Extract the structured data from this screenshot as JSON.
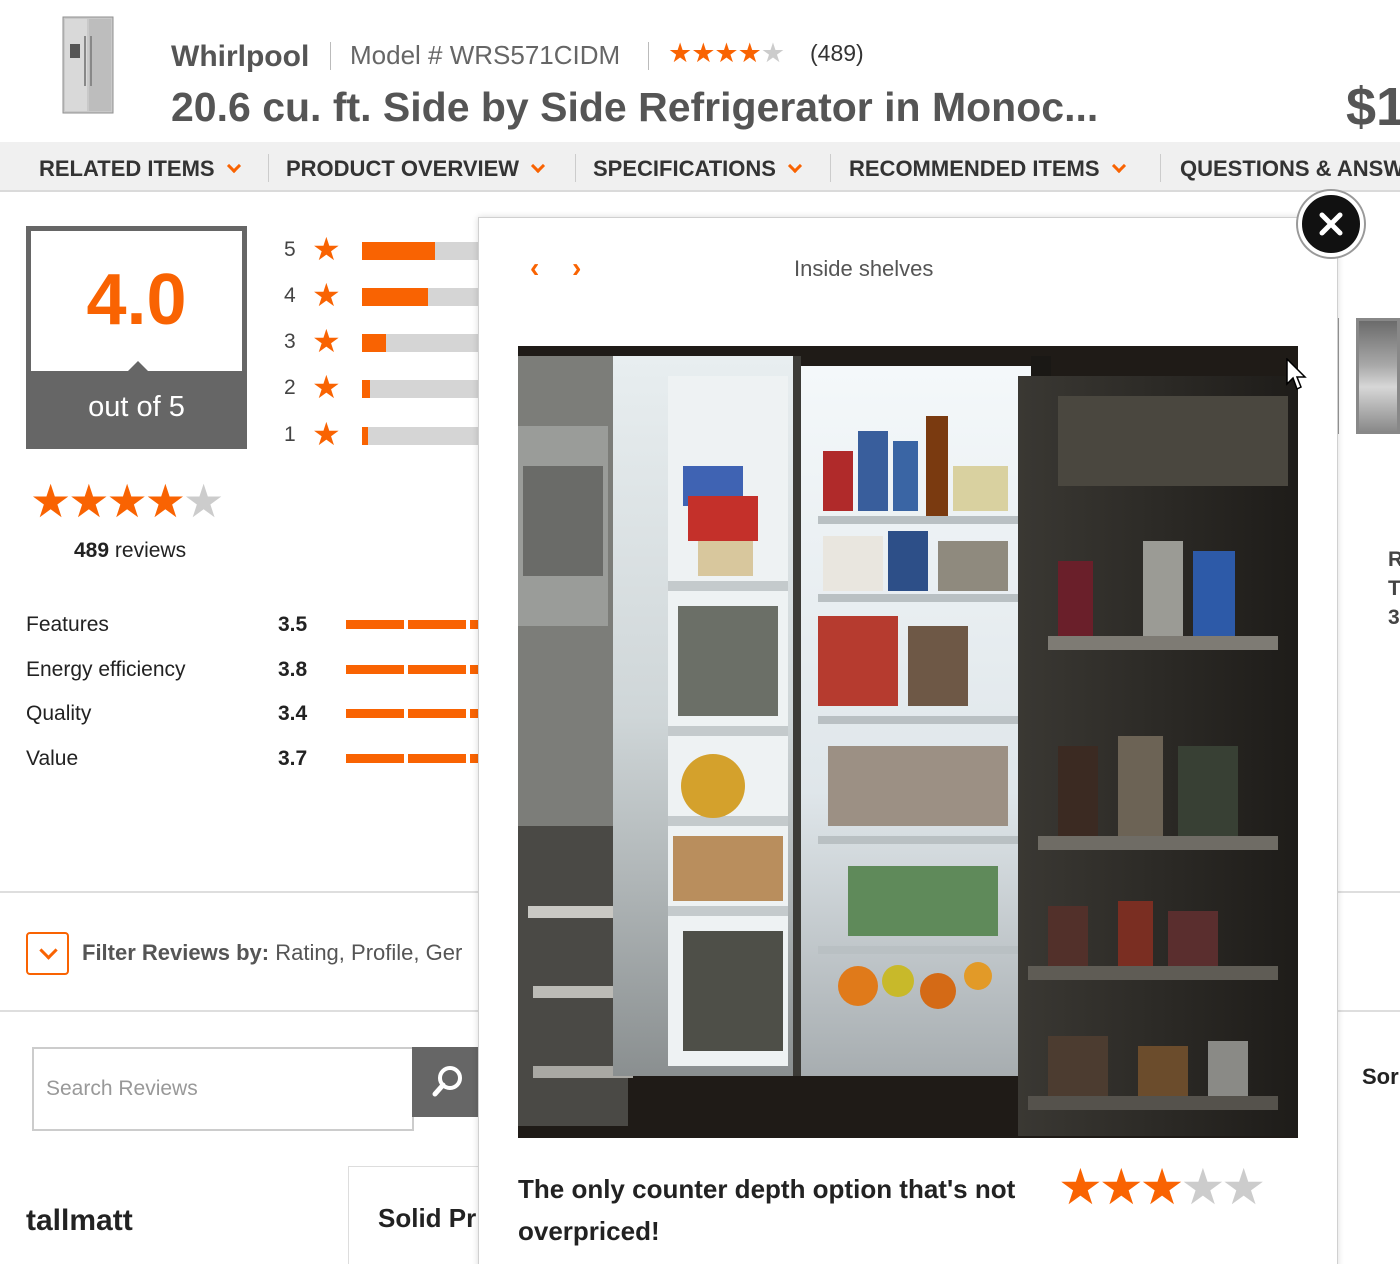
{
  "header": {
    "brand": "Whirlpool",
    "model": "Model # WRS571CIDM",
    "rating_count": "(489)",
    "title": "20.6 cu. ft. Side by Side Refrigerator in Monoc...",
    "price_partial": "$1"
  },
  "nav": {
    "items": [
      {
        "label": "RELATED ITEMS"
      },
      {
        "label": "PRODUCT OVERVIEW"
      },
      {
        "label": "SPECIFICATIONS"
      },
      {
        "label": "RECOMMENDED ITEMS"
      },
      {
        "label": "QUESTIONS & ANSW"
      }
    ]
  },
  "summary": {
    "average": "4.0",
    "out_of": "out of 5",
    "stars": 4,
    "reviews_count": "489",
    "reviews_label": "reviews",
    "distribution": [
      {
        "star": "5",
        "fraction": 0.61
      },
      {
        "star": "4",
        "fraction": 0.55
      },
      {
        "star": "3",
        "fraction": 0.2
      },
      {
        "star": "2",
        "fraction": 0.07
      },
      {
        "star": "1",
        "fraction": 0.05
      }
    ],
    "attributes": [
      {
        "label": "Features",
        "value": "3.5"
      },
      {
        "label": "Energy efficiency",
        "value": "3.8"
      },
      {
        "label": "Quality",
        "value": "3.4"
      },
      {
        "label": "Value",
        "value": "3.7"
      }
    ]
  },
  "filter": {
    "label": "Filter Reviews by:",
    "options": "Rating, Profile, Ger"
  },
  "search": {
    "placeholder": "Search Reviews"
  },
  "review": {
    "author": "tallmatt",
    "title_partial": "Solid Pr"
  },
  "right_partial": {
    "letters": [
      "R",
      "T",
      "3"
    ],
    "sort": "Sor"
  },
  "modal": {
    "caption": "Inside shelves",
    "review_title": "The only counter depth option that's not overpriced!",
    "review_stars": 3
  },
  "colors": {
    "accent": "#f96302",
    "dark_gray": "#666666",
    "star_empty": "#cccccc"
  }
}
